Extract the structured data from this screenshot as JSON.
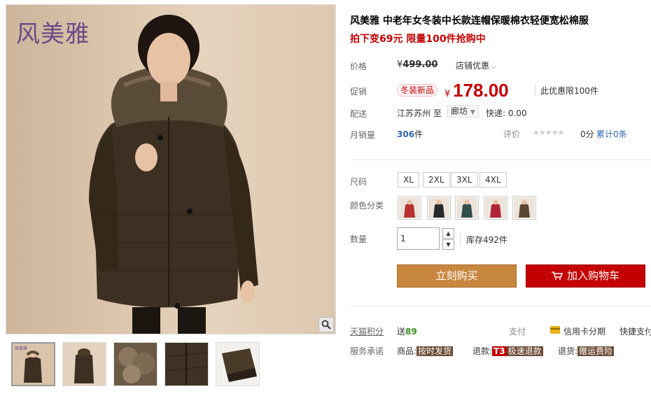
{
  "gallery": {
    "brand": "风美雅",
    "zoom_icon": "magnifier-icon",
    "thumbnails": [
      {
        "name": "thumb-front",
        "active": true
      },
      {
        "name": "thumb-back",
        "active": false
      },
      {
        "name": "thumb-hood",
        "active": false
      },
      {
        "name": "thumb-pocket",
        "active": false
      },
      {
        "name": "thumb-cuff",
        "active": false
      }
    ],
    "thumb_brand": "风美雅"
  },
  "product": {
    "title": "风美雅 中老年女冬装中长款连帽保暖棉衣轻便宽松棉服",
    "promo_line": "拍下变69元 限量100件抢购中"
  },
  "price": {
    "label": "价格",
    "currency": "¥",
    "original": "499.00",
    "shop_promo": "店铺优惠",
    "promo_label": "促销",
    "promo_tag": "冬装新品",
    "current": "178.00",
    "limit_note": "此优惠限100件"
  },
  "shipping": {
    "label": "配送",
    "from": "江苏苏州",
    "to_word": "至",
    "to": "廊坊",
    "fee": "快递: 0.00"
  },
  "sales": {
    "label": "月销量",
    "count": "306",
    "unit": "件",
    "rating_label": "评价",
    "stars": "★★★★★",
    "score": "0分",
    "reviews": "累计0条"
  },
  "size": {
    "label": "尺码",
    "options": [
      "XL",
      "2XL",
      "3XL",
      "4XL"
    ]
  },
  "color": {
    "label": "颜色分类",
    "swatches": [
      "#b8302f",
      "#2a2a2a",
      "#2f4d4a",
      "#b0243a",
      "#5b4731"
    ]
  },
  "quantity": {
    "label": "数量",
    "value": "1",
    "up": "▲",
    "down": "▼",
    "stock": "库存492件"
  },
  "actions": {
    "buy": "立刻购买",
    "cart": "加入购物车"
  },
  "footer": {
    "points_label": "天猫积分",
    "points_prefix": "送",
    "points": "89",
    "pay_label": "支付",
    "card_label": "信用卡分期",
    "quick_label": "快捷支付",
    "service_label": "服务承诺",
    "goods_prefix": "商品:",
    "goods_badge": "按时发货",
    "refund_prefix": "退款:",
    "refund_t3": "T3",
    "refund_badge": "极速退款",
    "return_prefix": "退货:",
    "return_badge": "赠运费险"
  },
  "colors": {
    "accent_red": "#c40000",
    "buy_orange": "#c8873f",
    "link_blue": "#2f66b3"
  }
}
